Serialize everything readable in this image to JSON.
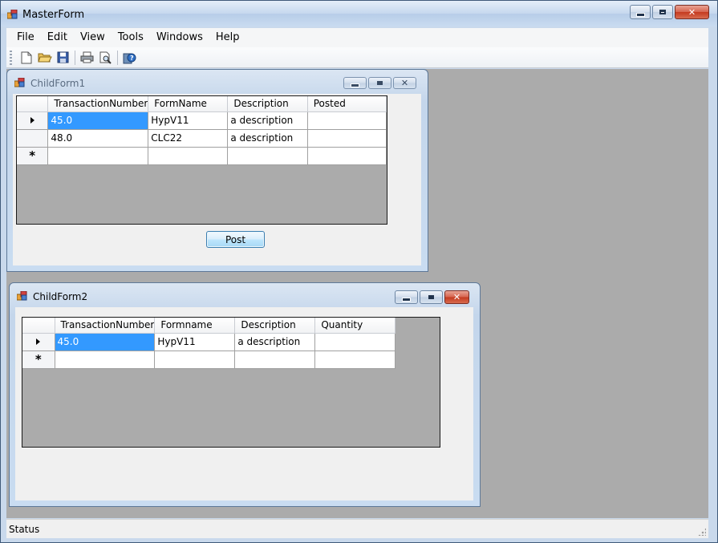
{
  "master": {
    "title": "MasterForm",
    "menu": [
      "File",
      "Edit",
      "View",
      "Tools",
      "Windows",
      "Help"
    ],
    "toolbar_icons": [
      "new-file-icon",
      "open-folder-icon",
      "save-icon",
      "print-icon",
      "print-preview-icon",
      "help-icon"
    ],
    "status": "Status"
  },
  "child1": {
    "title": "ChildForm1",
    "columns": [
      "TransactionNumber",
      "FormName",
      "Description",
      "Posted"
    ],
    "rows": [
      [
        "45.0",
        "HypV11",
        "a description",
        ""
      ],
      [
        "48.0",
        "CLC22",
        "a description",
        ""
      ]
    ],
    "post_label": "Post"
  },
  "child2": {
    "title": "ChildForm2",
    "columns": [
      "TransactionNumber",
      "Formname",
      "Description",
      "Quantity"
    ],
    "rows": [
      [
        "45.0",
        "HypV11",
        "a description",
        ""
      ]
    ]
  },
  "colors": {
    "selection": "#3399ff",
    "mdi_background": "#ababab",
    "close_button": "#c4391f"
  }
}
